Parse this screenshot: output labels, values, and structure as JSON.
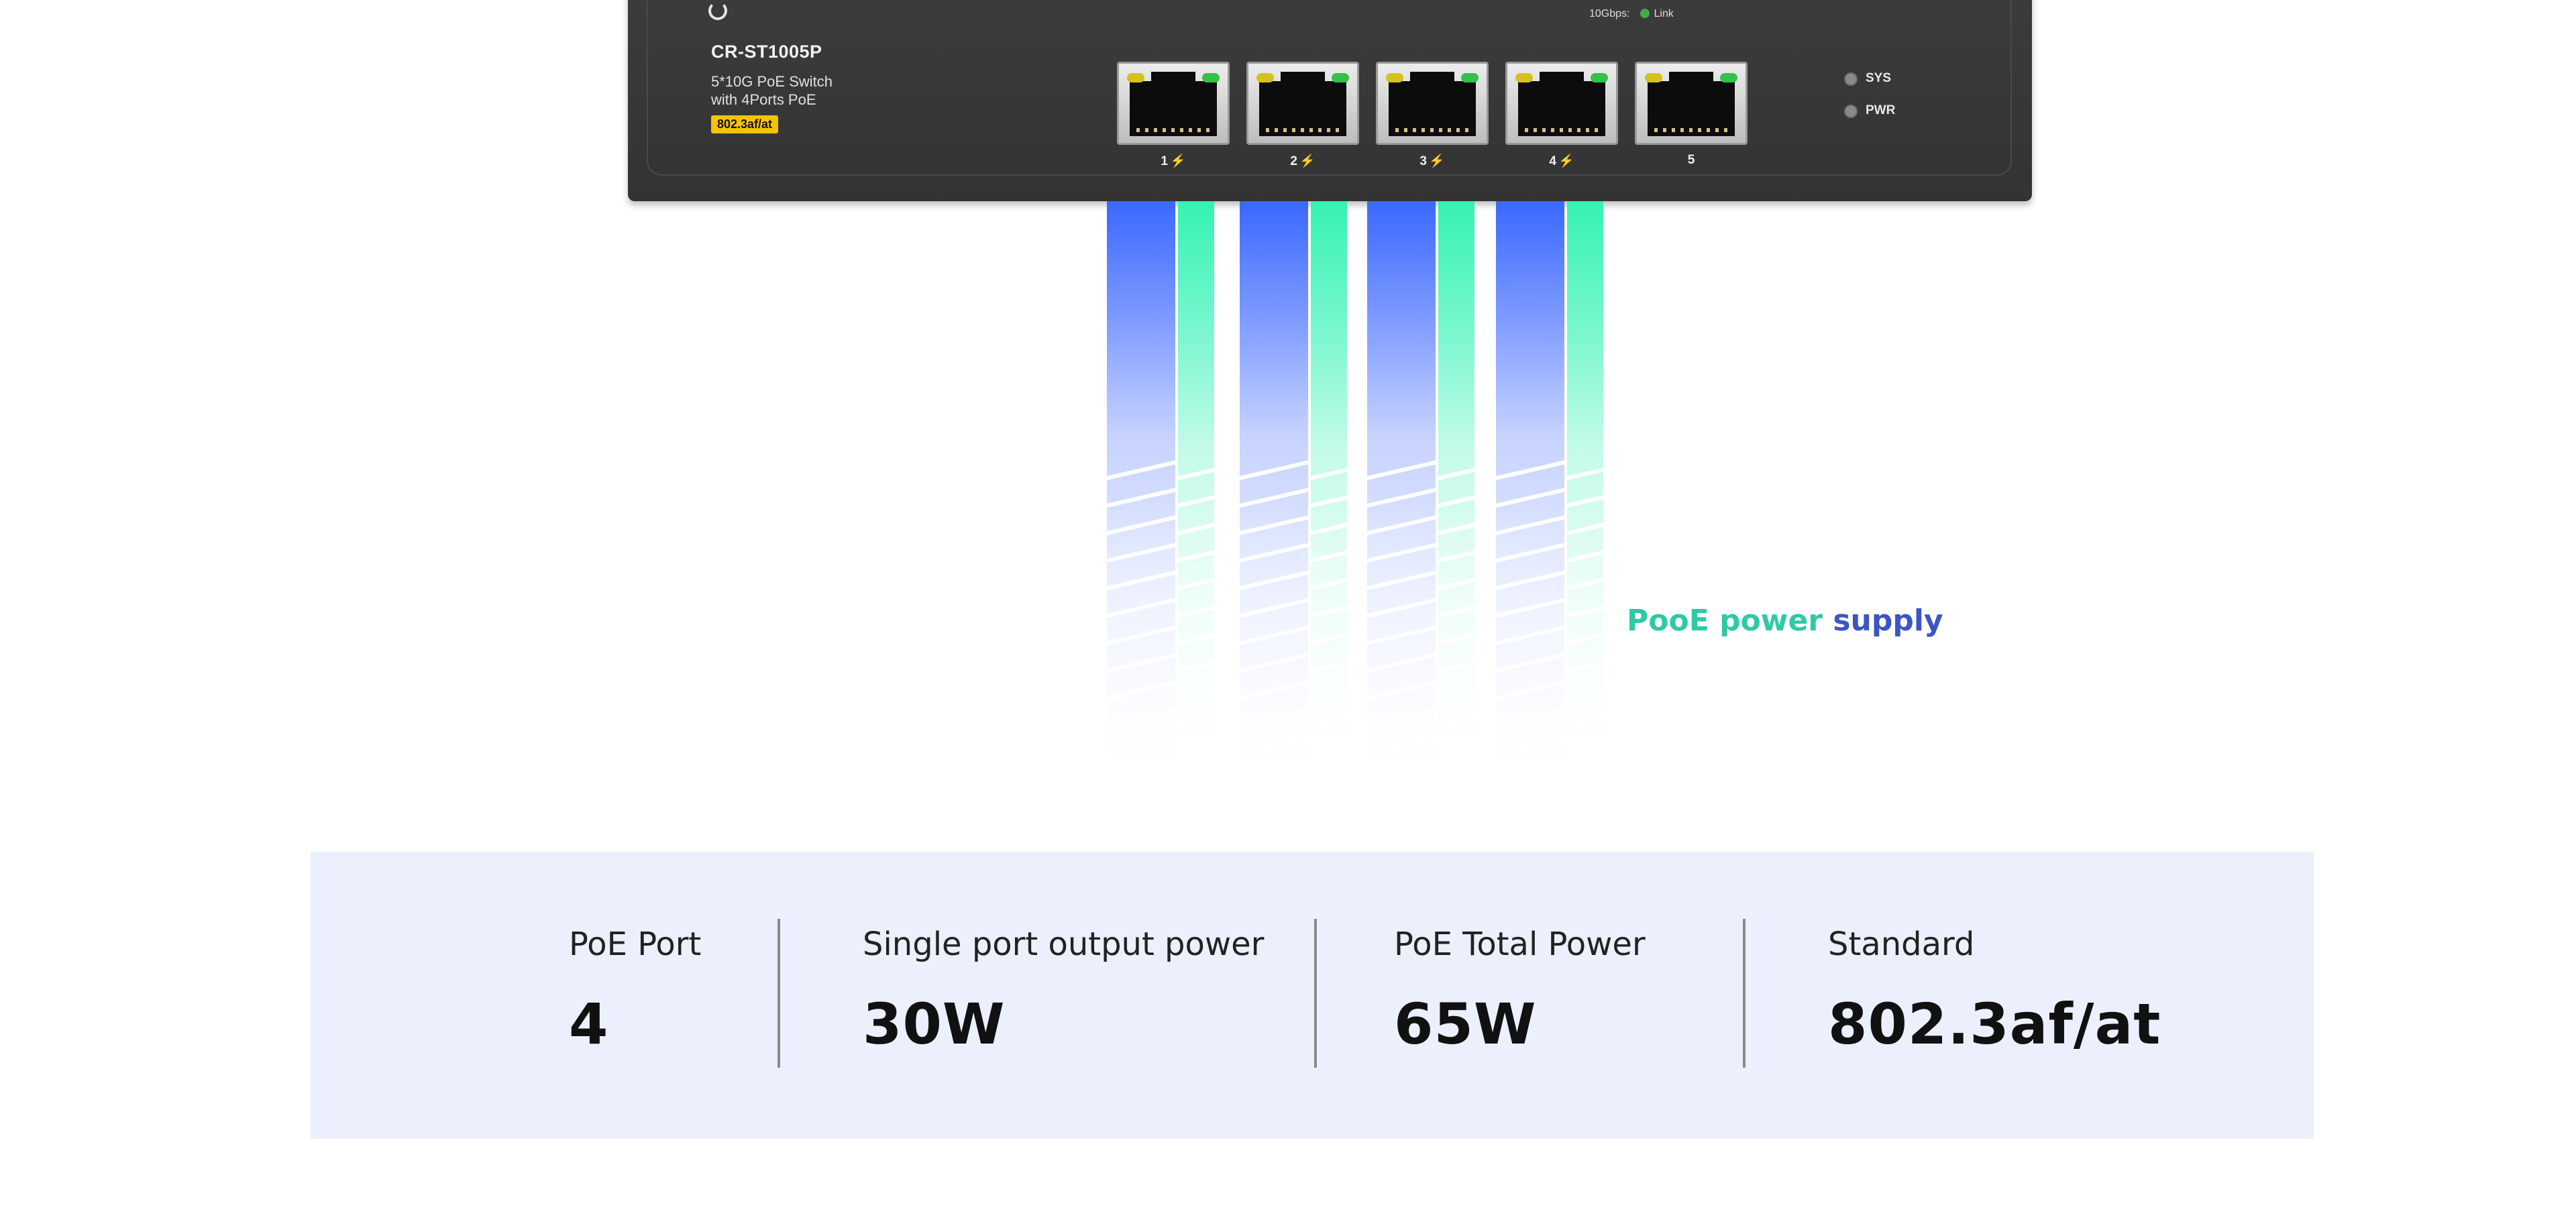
{
  "device": {
    "model": "CR-ST1005P",
    "description_line1": "5*10G PoE Switch",
    "description_line2": "with 4Ports PoE",
    "standard_badge": "802.3af/at",
    "speed_label": "10Gbps:",
    "link_label": "Link",
    "ports": [
      {
        "label": "1",
        "poe": true
      },
      {
        "label": "2",
        "poe": true
      },
      {
        "label": "3",
        "poe": true
      },
      {
        "label": "4",
        "poe": true
      },
      {
        "label": "5",
        "poe": false
      }
    ],
    "poe_icon": "⚡",
    "status_indicators": [
      {
        "label": "SYS"
      },
      {
        "label": "PWR"
      }
    ]
  },
  "tagline": {
    "part1": "PooE power",
    "part2": " supply",
    "color_part1": "#2fc9a6",
    "color_part2": "#3b55c4"
  },
  "specs": [
    {
      "label": "PoE Port",
      "value": "4"
    },
    {
      "label": "Single port output power",
      "value": "30W"
    },
    {
      "label": "PoE Total Power",
      "value": "65W"
    },
    {
      "label": "Standard",
      "value": "802.3af/at"
    }
  ],
  "colors": {
    "beam_blue": "#3a68ff",
    "beam_green": "#35f2b1",
    "panel_bg": "#ecf0fd",
    "badge": "#f5c400"
  }
}
